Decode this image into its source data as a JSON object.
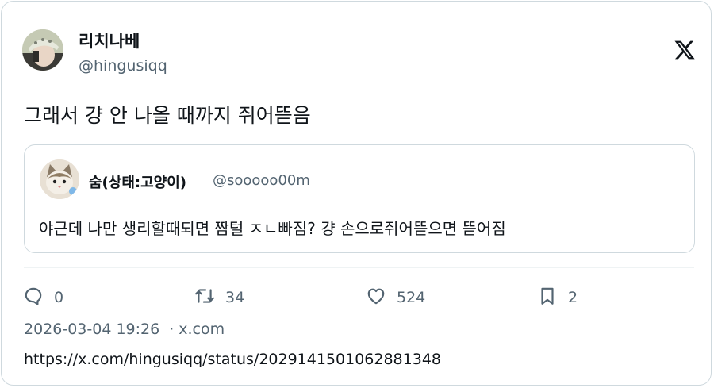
{
  "author": {
    "display_name": "리치나베",
    "handle": "@hingusiqq"
  },
  "tweet": {
    "text": "그래서 걍 안 나올 때까지 쥐어뜯음"
  },
  "quoted_tweet": {
    "display_name": "숨(상태:고양이)",
    "handle": "@sooooo00m",
    "text": "야근데 나만 생리할때되면 짬털 ㅈㄴ빠짐? 걍 손으로쥐어뜯으면 뜯어짐"
  },
  "actions": {
    "replies": "0",
    "retweets": "34",
    "likes": "524",
    "bookmarks": "2"
  },
  "meta": {
    "timestamp": "2026-03-04 19:26",
    "separator": "·",
    "domain": "x.com",
    "url": "https://x.com/hingusiqq/status/2029141501062881348"
  },
  "icons": {
    "brand": "x-logo-icon",
    "reply": "reply-bubble-icon",
    "retweet": "retweet-icon",
    "like": "heart-icon",
    "bookmark": "bookmark-icon"
  },
  "colors": {
    "text_primary": "#0f1419",
    "text_secondary": "#536471",
    "border": "#cfd9de"
  }
}
